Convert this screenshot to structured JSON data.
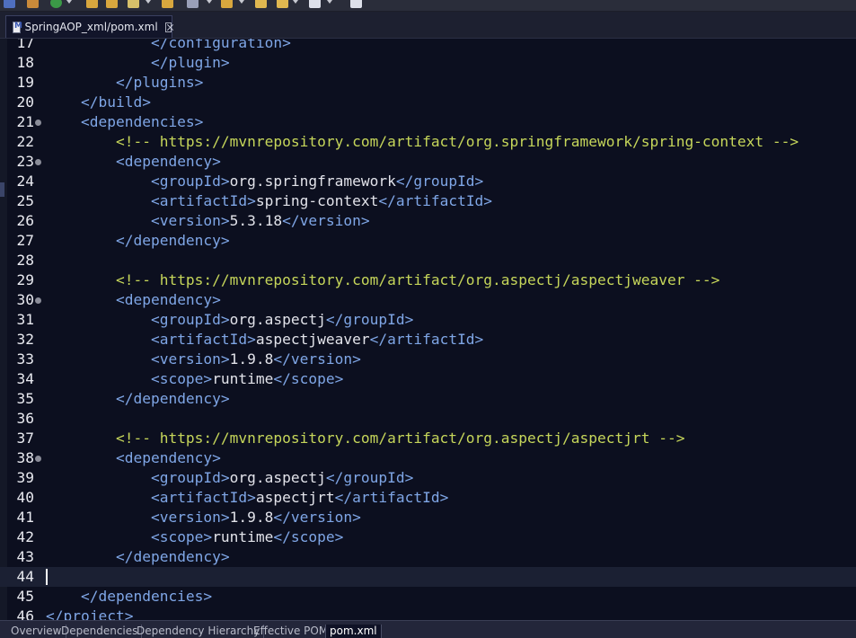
{
  "toolbar": {
    "icons": [
      "file-icon",
      "save-icon",
      "run-icon",
      "open-folder-icon",
      "bookmark-icon",
      "annotation-icon",
      "back-arrow-icon",
      "forward-arrow-icon",
      "task-icon"
    ]
  },
  "editor_tab": {
    "file_icon": "M",
    "label": "SpringAOP_xml/pom.xml"
  },
  "colors": {
    "background": "#0c0f1f",
    "tag": "#7fa6e6",
    "text": "#e2e3ea",
    "comment": "#c6d65a",
    "line_number": "#e9eaf0",
    "current_line": "#1b2033"
  },
  "editor": {
    "current_line": "44",
    "lines": [
      {
        "n": "17",
        "fold": false,
        "indent": "            ",
        "parts": [
          {
            "k": "t",
            "v": "</configuration>"
          }
        ]
      },
      {
        "n": "18",
        "fold": false,
        "indent": "            ",
        "parts": [
          {
            "k": "t",
            "v": "</plugin>"
          }
        ]
      },
      {
        "n": "19",
        "fold": false,
        "indent": "        ",
        "parts": [
          {
            "k": "t",
            "v": "</plugins>"
          }
        ]
      },
      {
        "n": "20",
        "fold": false,
        "indent": "    ",
        "parts": [
          {
            "k": "t",
            "v": "</build>"
          }
        ]
      },
      {
        "n": "21",
        "fold": true,
        "indent": "    ",
        "parts": [
          {
            "k": "t",
            "v": "<dependencies>"
          }
        ]
      },
      {
        "n": "22",
        "fold": false,
        "indent": "        ",
        "parts": [
          {
            "k": "c",
            "v": "<!-- https://mvnrepository.com/artifact/org.springframework/spring-context -->"
          }
        ]
      },
      {
        "n": "23",
        "fold": true,
        "indent": "        ",
        "parts": [
          {
            "k": "t",
            "v": "<dependency>"
          }
        ]
      },
      {
        "n": "24",
        "fold": false,
        "indent": "            ",
        "parts": [
          {
            "k": "t",
            "v": "<groupId>"
          },
          {
            "k": "x",
            "v": "org.springframework"
          },
          {
            "k": "t",
            "v": "</groupId>"
          }
        ]
      },
      {
        "n": "25",
        "fold": false,
        "indent": "            ",
        "parts": [
          {
            "k": "t",
            "v": "<artifactId>"
          },
          {
            "k": "x",
            "v": "spring-context"
          },
          {
            "k": "t",
            "v": "</artifactId>"
          }
        ]
      },
      {
        "n": "26",
        "fold": false,
        "indent": "            ",
        "parts": [
          {
            "k": "t",
            "v": "<version>"
          },
          {
            "k": "x",
            "v": "5.3.18"
          },
          {
            "k": "t",
            "v": "</version>"
          }
        ]
      },
      {
        "n": "27",
        "fold": false,
        "indent": "        ",
        "parts": [
          {
            "k": "t",
            "v": "</dependency>"
          }
        ]
      },
      {
        "n": "28",
        "fold": false,
        "indent": "",
        "parts": []
      },
      {
        "n": "29",
        "fold": false,
        "indent": "        ",
        "parts": [
          {
            "k": "c",
            "v": "<!-- https://mvnrepository.com/artifact/org.aspectj/aspectjweaver -->"
          }
        ]
      },
      {
        "n": "30",
        "fold": true,
        "indent": "        ",
        "parts": [
          {
            "k": "t",
            "v": "<dependency>"
          }
        ]
      },
      {
        "n": "31",
        "fold": false,
        "indent": "            ",
        "parts": [
          {
            "k": "t",
            "v": "<groupId>"
          },
          {
            "k": "x",
            "v": "org.aspectj"
          },
          {
            "k": "t",
            "v": "</groupId>"
          }
        ]
      },
      {
        "n": "32",
        "fold": false,
        "indent": "            ",
        "parts": [
          {
            "k": "t",
            "v": "<artifactId>"
          },
          {
            "k": "x",
            "v": "aspectjweaver"
          },
          {
            "k": "t",
            "v": "</artifactId>"
          }
        ]
      },
      {
        "n": "33",
        "fold": false,
        "indent": "            ",
        "parts": [
          {
            "k": "t",
            "v": "<version>"
          },
          {
            "k": "x",
            "v": "1.9.8"
          },
          {
            "k": "t",
            "v": "</version>"
          }
        ]
      },
      {
        "n": "34",
        "fold": false,
        "indent": "            ",
        "parts": [
          {
            "k": "t",
            "v": "<scope>"
          },
          {
            "k": "x",
            "v": "runtime"
          },
          {
            "k": "t",
            "v": "</scope>"
          }
        ]
      },
      {
        "n": "35",
        "fold": false,
        "indent": "        ",
        "parts": [
          {
            "k": "t",
            "v": "</dependency>"
          }
        ]
      },
      {
        "n": "36",
        "fold": false,
        "indent": "",
        "parts": []
      },
      {
        "n": "37",
        "fold": false,
        "indent": "        ",
        "parts": [
          {
            "k": "c",
            "v": "<!-- https://mvnrepository.com/artifact/org.aspectj/aspectjrt -->"
          }
        ]
      },
      {
        "n": "38",
        "fold": true,
        "indent": "        ",
        "parts": [
          {
            "k": "t",
            "v": "<dependency>"
          }
        ]
      },
      {
        "n": "39",
        "fold": false,
        "indent": "            ",
        "parts": [
          {
            "k": "t",
            "v": "<groupId>"
          },
          {
            "k": "x",
            "v": "org.aspectj"
          },
          {
            "k": "t",
            "v": "</groupId>"
          }
        ]
      },
      {
        "n": "40",
        "fold": false,
        "indent": "            ",
        "parts": [
          {
            "k": "t",
            "v": "<artifactId>"
          },
          {
            "k": "x",
            "v": "aspectjrt"
          },
          {
            "k": "t",
            "v": "</artifactId>"
          }
        ]
      },
      {
        "n": "41",
        "fold": false,
        "indent": "            ",
        "parts": [
          {
            "k": "t",
            "v": "<version>"
          },
          {
            "k": "x",
            "v": "1.9.8"
          },
          {
            "k": "t",
            "v": "</version>"
          }
        ]
      },
      {
        "n": "42",
        "fold": false,
        "indent": "            ",
        "parts": [
          {
            "k": "t",
            "v": "<scope>"
          },
          {
            "k": "x",
            "v": "runtime"
          },
          {
            "k": "t",
            "v": "</scope>"
          }
        ]
      },
      {
        "n": "43",
        "fold": false,
        "indent": "        ",
        "parts": [
          {
            "k": "t",
            "v": "</dependency>"
          }
        ]
      },
      {
        "n": "44",
        "fold": false,
        "indent": "",
        "parts": []
      },
      {
        "n": "45",
        "fold": false,
        "indent": "    ",
        "parts": [
          {
            "k": "t",
            "v": "</dependencies>"
          }
        ]
      },
      {
        "n": "46",
        "fold": false,
        "indent": "",
        "parts": [
          {
            "k": "t",
            "v": "</project>"
          }
        ]
      }
    ]
  },
  "bottom_tabs": [
    {
      "label": "Overview",
      "active": false
    },
    {
      "label": "Dependencies",
      "active": false
    },
    {
      "label": "Dependency Hierarchy",
      "active": false
    },
    {
      "label": "Effective POM",
      "active": false
    },
    {
      "label": "pom.xml",
      "active": true
    }
  ]
}
